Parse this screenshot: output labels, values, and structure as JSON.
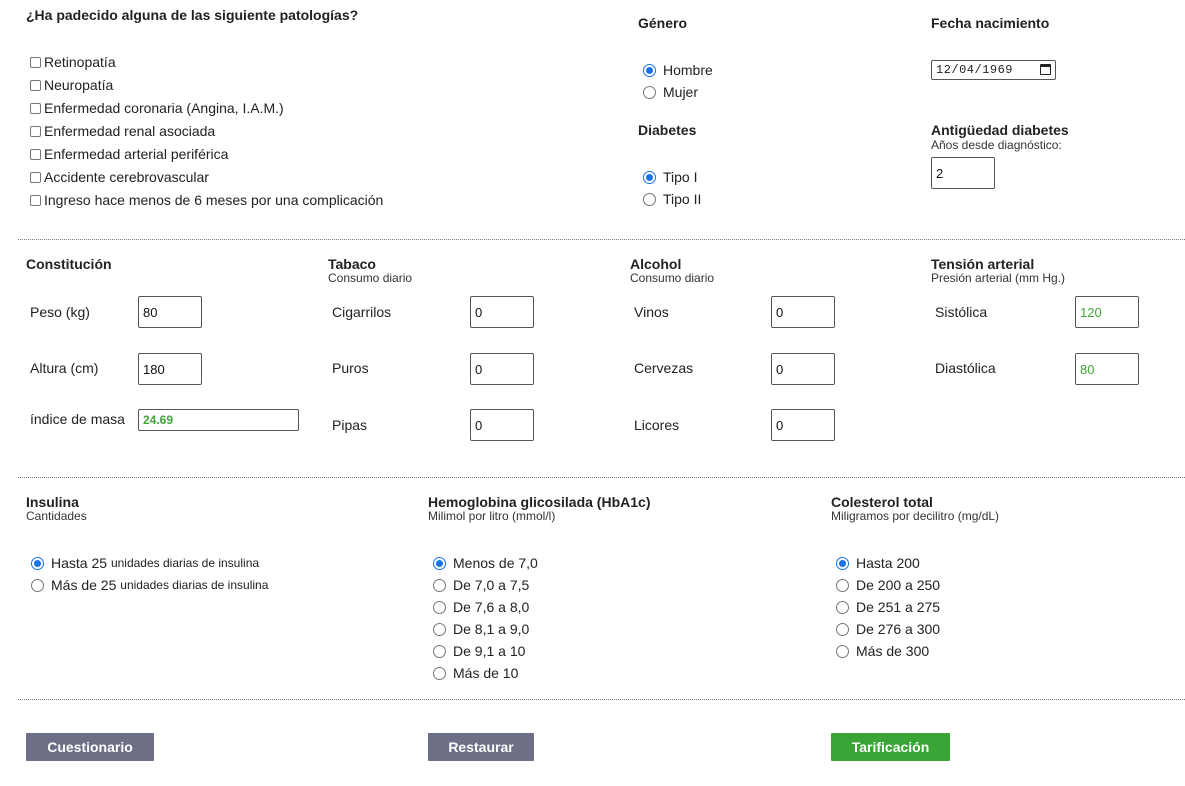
{
  "pathologies": {
    "title": "¿Ha padecido alguna de las siguiente patologías?",
    "items": [
      "Retinopatía",
      "Neuropatía",
      "Enfermedad coronaria (Angina, I.A.M.)",
      "Enfermedad renal asociada",
      "Enfermedad arterial periférica",
      "Accidente cerebrovascular",
      "Ingreso hace menos de 6 meses por una complicación"
    ]
  },
  "gender": {
    "title": "Género",
    "options": [
      "Hombre",
      "Mujer"
    ],
    "selected": "Hombre"
  },
  "birthdate": {
    "title": "Fecha nacimiento",
    "value": "12/04/1969"
  },
  "diabetes": {
    "title": "Diabetes",
    "options": [
      "Tipo I",
      "Tipo II"
    ],
    "selected": "Tipo I"
  },
  "seniority": {
    "title": "Antigüedad diabetes",
    "subtitle": "Años desde diagnóstico:",
    "value": "2"
  },
  "constitution": {
    "title": "Constitución",
    "weight_label": "Peso (kg)",
    "weight": "80",
    "height_label": "Altura (cm)",
    "height": "180",
    "bmi_label": "índice de masa",
    "bmi": "24.69"
  },
  "tobacco": {
    "title": "Tabaco",
    "subtitle": "Consumo diario",
    "cigarettes_label": "Cigarrilos",
    "cigarettes": "0",
    "cigars_label": "Puros",
    "cigars": "0",
    "pipes_label": "Pipas",
    "pipes": "0"
  },
  "alcohol": {
    "title": "Alcohol",
    "subtitle": "Consumo diario",
    "wines_label": "Vinos",
    "wines": "0",
    "beers_label": "Cervezas",
    "beers": "0",
    "liquors_label": "Licores",
    "liquors": "0"
  },
  "pressure": {
    "title": "Tensión arterial",
    "subtitle": "Presión arterial (mm Hg.)",
    "systolic_label": "Sistólica",
    "systolic": "120",
    "diastolic_label": "Diastólica",
    "diastolic": "80"
  },
  "insulin": {
    "title": "Insulina",
    "subtitle": "Cantidades",
    "options": [
      {
        "main": "Hasta 25",
        "small": "unidades diarias de insulina"
      },
      {
        "main": "Más de 25",
        "small": "unidades diarias de insulina"
      }
    ],
    "selected_index": 0
  },
  "hba1c": {
    "title": "Hemoglobina glicosilada (HbA1c)",
    "subtitle": "Milimol por litro (mmol/l)",
    "options": [
      "Menos de 7,0",
      "De 7,0 a 7,5",
      "De 7,6 a 8,0",
      "De 8,1 a 9,0",
      "De 9,1 a 10",
      "Más de 10"
    ],
    "selected_index": 0
  },
  "cholesterol": {
    "title": "Colesterol total",
    "subtitle": "Miligramos por decilitro (mg/dL)",
    "options": [
      "Hasta 200",
      "De 200 a 250",
      "De 251 a 275",
      "De 276 a 300",
      "Más de 300"
    ],
    "selected_index": 0
  },
  "buttons": {
    "questionnaire": "Cuestionario",
    "reset": "Restaurar",
    "pricing": "Tarificación"
  },
  "colors": {
    "accent_blue": "#1a73e8",
    "green_value": "#3fa535",
    "gray_button": "#6c6f85",
    "green_button": "#3aa437"
  }
}
